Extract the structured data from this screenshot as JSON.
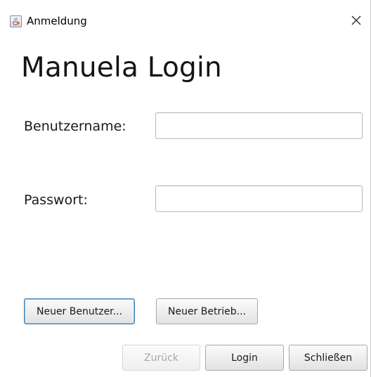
{
  "window": {
    "title": "Anmeldung",
    "icon": "java-cup-icon"
  },
  "main": {
    "heading": "Manuela Login",
    "username_label": "Benutzername:",
    "username_value": "",
    "password_label": "Passwort:",
    "password_value": ""
  },
  "actions": {
    "new_user_label": "Neuer Benutzer...",
    "new_business_label": "Neuer Betrieb...",
    "back_label": "Zurück",
    "login_label": "Login",
    "close_label": "Schließen"
  },
  "colors": {
    "focus_border": "#3c7fb1",
    "disabled_text": "#a8a8a8"
  }
}
